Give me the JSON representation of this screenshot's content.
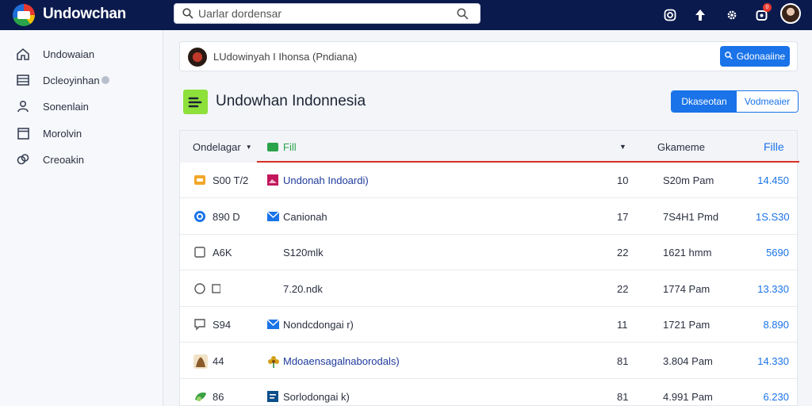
{
  "app": {
    "title": "Undowchan"
  },
  "search": {
    "placeholder": "Uarlar dordensar"
  },
  "topbar": {
    "notification_count": "0",
    "icons": [
      "instagram-icon",
      "upload-arrow-icon",
      "settings-gear-icon",
      "notifications-icon",
      "user-avatar"
    ]
  },
  "sidebar": {
    "items": [
      {
        "label": "Undowaian",
        "icon": "home-icon"
      },
      {
        "label": "Dcleoyinhan",
        "icon": "list-icon"
      },
      {
        "label": "Sonenlain",
        "icon": "person-icon"
      },
      {
        "label": "Morolvin",
        "icon": "window-icon"
      },
      {
        "label": "Creoakin",
        "icon": "shield-icon"
      }
    ]
  },
  "breadcrumb": {
    "text": "LUdowinyah I Ihonsa (Pndiana)"
  },
  "actions": {
    "primary_label": "Gdonaaiine"
  },
  "org": {
    "title": "Undowhan Indonnesia",
    "segment_active": "Dkaseotan",
    "segment_inactive": "Vodmeaier"
  },
  "table": {
    "columns": {
      "c1": "Ondelagar",
      "c2": "Fill",
      "c3": "Gkameme",
      "c4": "Fille"
    },
    "rows": [
      {
        "code": "S00 T/2",
        "name": "Undonah Indoardi)",
        "num": "10",
        "time": "S20m Pam",
        "file": "14.450",
        "icon": "folder-icon",
        "name_icon": "image-icon",
        "icon_color": "#f4a62a",
        "name_icon_color": "#c2185b"
      },
      {
        "code": "890 D",
        "name": "Canionah",
        "num": "17",
        "time": "7S4H1 Pmd",
        "file": "1S.S30",
        "icon": "copyright-circle-icon",
        "name_icon": "mail-icon",
        "icon_color": "#1a73e8",
        "name_icon_color": "#1a73e8"
      },
      {
        "code": "A6K",
        "name": "S120mlk",
        "num": "22",
        "time": "1621 hmm",
        "file": "5690",
        "icon": "checkbox-icon",
        "name_icon": "",
        "icon_color": "#555",
        "name_icon_color": ""
      },
      {
        "code": "",
        "name": "7.20.ndk",
        "num": "22",
        "time": "1774 Pam",
        "file": "13.330",
        "icon": "radio-icon",
        "name_icon": "",
        "icon_color": "#555",
        "name_icon_color": ""
      },
      {
        "code": "S94",
        "name": "Nondcdongai r)",
        "num": "11",
        "time": "1721 Pam",
        "file": "8.890",
        "icon": "comment-icon",
        "name_icon": "mail-icon",
        "icon_color": "#555",
        "name_icon_color": "#1a73e8"
      },
      {
        "code": "44",
        "name": "Mdoaensagalnaborodals)",
        "num": "81",
        "time": "3.804 Pam",
        "file": "14.330",
        "icon": "photo-thumb-icon",
        "name_icon": "flower-icon",
        "icon_color": "#8a5a2b",
        "name_icon_color": "#d4a017"
      },
      {
        "code": "86",
        "name": "Sorlodongai k)",
        "num": "81",
        "time": "4.991 Pam",
        "file": "6.230",
        "icon": "leaf-icon",
        "name_icon": "file-icon",
        "icon_color": "#3aa043",
        "name_icon_color": "#0b4f8a"
      }
    ]
  },
  "colors": {
    "topbar": "#0b1a4d",
    "accent": "#1a73e8",
    "table_underline": "#d93025",
    "org_logo": "#8ee03a"
  }
}
